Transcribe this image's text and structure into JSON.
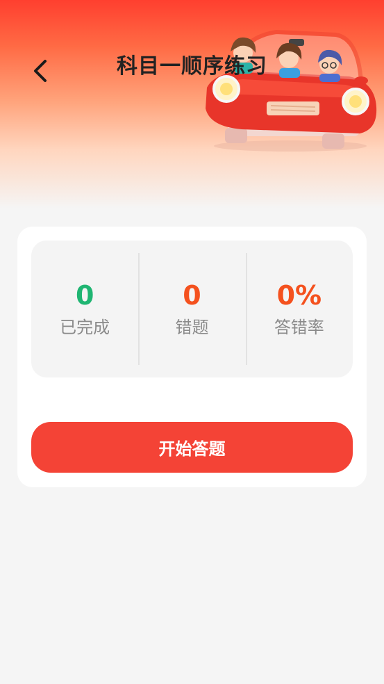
{
  "header": {
    "title": "科目一顺序练习",
    "back_icon": "chevron-left-icon",
    "illustration": "red-car-with-passengers"
  },
  "stats": [
    {
      "value": "0",
      "label": "已完成",
      "color": "#1fb572"
    },
    {
      "value": "0",
      "label": "错题",
      "color": "#f4511e"
    },
    {
      "value": "0%",
      "label": "答错率",
      "color": "#f4511e"
    }
  ],
  "actions": {
    "start_label": "开始答题"
  },
  "colors": {
    "accent": "#f44336",
    "header_top": "#ff3f2f",
    "background": "#f5f5f5"
  }
}
